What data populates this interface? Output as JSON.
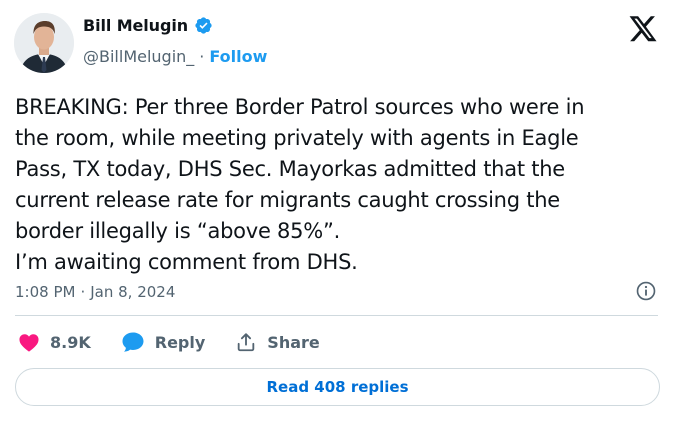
{
  "author": {
    "display_name": "Bill Melugin",
    "handle": "@BillMelugin_",
    "separator": "·",
    "follow_label": "Follow",
    "verified": true
  },
  "tweet": {
    "text": "BREAKING: Per three Border Patrol sources who were in\nthe room, while meeting privately with agents in Eagle\nPass, TX today, DHS Sec. Mayorkas admitted that the\ncurrent release rate for migrants caught crossing the\nborder illegally is “above 85%”.\nI’m awaiting comment from DHS.",
    "time": "1:08 PM",
    "separator": "·",
    "date": "Jan 8, 2024"
  },
  "actions": {
    "likes": "8.9K",
    "reply_label": "Reply",
    "share_label": "Share"
  },
  "footer": {
    "read_replies_label": "Read 408 replies"
  },
  "colors": {
    "accent": "#1d9bf0",
    "link": "#006fd6",
    "like": "#f91880",
    "text_primary": "#0f1419",
    "text_secondary": "#536471",
    "border": "#cfd9de"
  },
  "icons": {
    "brand": "x-logo-icon",
    "verified": "verified-badge-icon",
    "info": "info-icon",
    "like": "heart-icon",
    "reply": "speech-bubble-icon",
    "share": "share-upload-icon"
  }
}
